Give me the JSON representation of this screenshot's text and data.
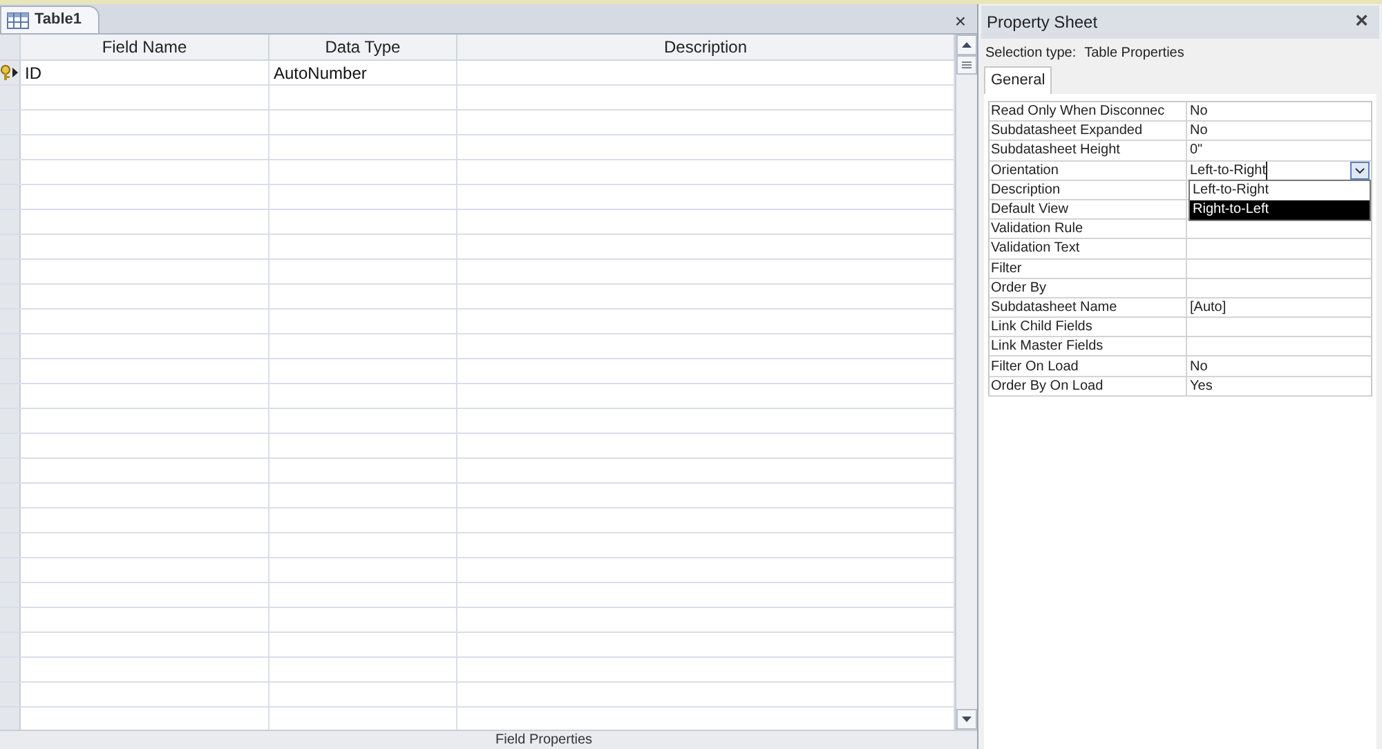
{
  "document_tab": {
    "title": "Table1",
    "close": "×"
  },
  "design_grid": {
    "columns": [
      "Field Name",
      "Data Type",
      "Description"
    ],
    "rows": [
      {
        "field_name": "ID",
        "data_type": "AutoNumber",
        "primary_key": true,
        "current": true
      }
    ]
  },
  "field_properties_bar": "Field Properties",
  "property_sheet": {
    "title": "Property Sheet",
    "close": "×",
    "selection_label": "Selection type:",
    "selection_value": "Table Properties",
    "tabs": [
      {
        "label": "General",
        "selected": true
      }
    ],
    "properties": [
      {
        "name": "Read Only When Disconnec",
        "value": "No"
      },
      {
        "name": "Subdatasheet Expanded",
        "value": "No"
      },
      {
        "name": "Subdatasheet Height",
        "value": "0\""
      },
      {
        "name": "Orientation",
        "value": "Left-to-Right",
        "editing": true
      },
      {
        "name": "Description"
      },
      {
        "name": "Default View"
      },
      {
        "name": "Validation Rule"
      },
      {
        "name": "Validation Text"
      },
      {
        "name": "Filter"
      },
      {
        "name": "Order By"
      },
      {
        "name": "Subdatasheet Name",
        "value": "[Auto]"
      },
      {
        "name": "Link Child Fields"
      },
      {
        "name": "Link Master Fields"
      },
      {
        "name": "Filter On Load",
        "value": "No"
      },
      {
        "name": "Order By On Load",
        "value": "Yes"
      }
    ],
    "dropdown": [
      {
        "label": "Left-to-Right",
        "selected": false
      },
      {
        "label": "Right-to-Left",
        "selected": true
      }
    ]
  }
}
